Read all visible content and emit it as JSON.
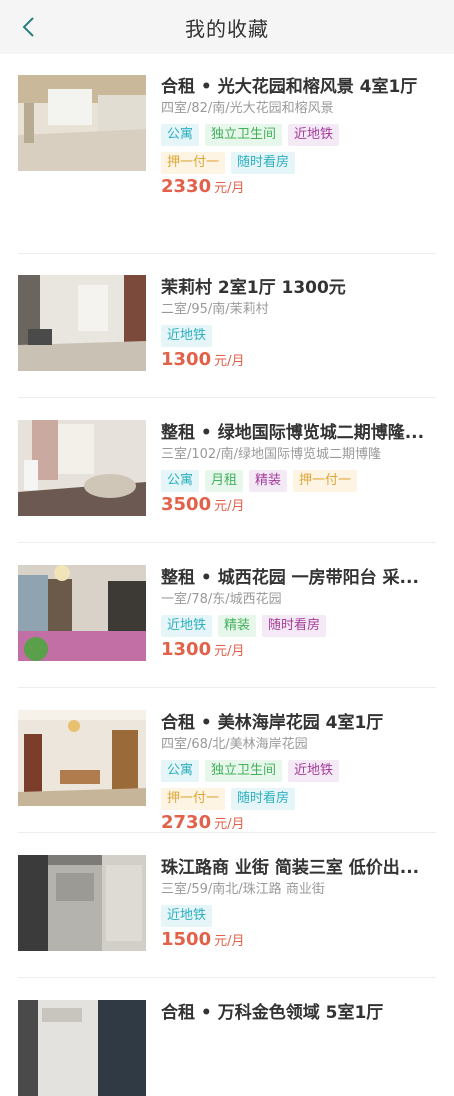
{
  "header": {
    "title": "我的收藏"
  },
  "items": [
    {
      "title": "合租 • 光大花园和榕风景 4室1厅",
      "sub": "四室/82/南/光大花园和榕风景",
      "tags": [
        {
          "t": "公寓",
          "c": "c1"
        },
        {
          "t": "独立卫生间",
          "c": "c2"
        },
        {
          "t": "近地铁",
          "c": "c3"
        },
        {
          "t": "押一付一",
          "c": "c4"
        },
        {
          "t": "随时看房",
          "c": "c1"
        }
      ],
      "price": "2330",
      "unit": "元/月"
    },
    {
      "title": "茉莉村 2室1厅 1300元",
      "sub": "二室/95/南/茉莉村",
      "tags": [
        {
          "t": "近地铁",
          "c": "c1"
        }
      ],
      "price": "1300",
      "unit": "元/月"
    },
    {
      "title": "整租 • 绿地国际博览城二期博隆...",
      "sub": "三室/102/南/绿地国际博览城二期博隆",
      "tags": [
        {
          "t": "公寓",
          "c": "c1"
        },
        {
          "t": "月租",
          "c": "c2"
        },
        {
          "t": "精装",
          "c": "c3"
        },
        {
          "t": "押一付一",
          "c": "c4"
        }
      ],
      "price": "3500",
      "unit": "元/月"
    },
    {
      "title": "整租 • 城西花园 一房带阳台 采...",
      "sub": "一室/78/东/城西花园",
      "tags": [
        {
          "t": "近地铁",
          "c": "c1"
        },
        {
          "t": "精装",
          "c": "c2"
        },
        {
          "t": "随时看房",
          "c": "c3"
        }
      ],
      "price": "1300",
      "unit": "元/月"
    },
    {
      "title": "合租 • 美林海岸花园 4室1厅",
      "sub": "四室/68/北/美林海岸花园",
      "tags": [
        {
          "t": "公寓",
          "c": "c1"
        },
        {
          "t": "独立卫生间",
          "c": "c2"
        },
        {
          "t": "近地铁",
          "c": "c3"
        },
        {
          "t": "押一付一",
          "c": "c4"
        },
        {
          "t": "随时看房",
          "c": "c1"
        }
      ],
      "price": "2730",
      "unit": "元/月"
    },
    {
      "title": "珠江路商 业街 简装三室 低价出...",
      "sub": "三室/59/南北/珠江路 商业街",
      "tags": [
        {
          "t": "近地铁",
          "c": "c1"
        }
      ],
      "price": "1500",
      "unit": "元/月"
    },
    {
      "title": "合租 • 万科金色领域 5室1厅",
      "sub": "",
      "tags": [],
      "price": "",
      "unit": ""
    }
  ]
}
